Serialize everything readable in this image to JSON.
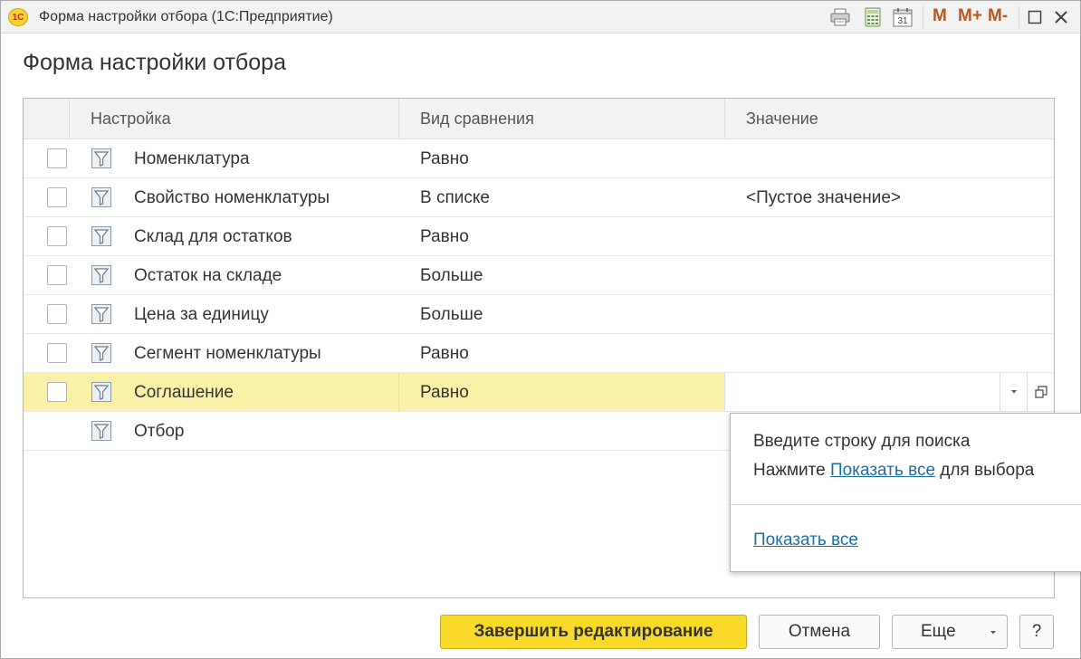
{
  "window": {
    "logo_text": "1С",
    "title": "Форма настройки отбора  (1С:Предприятие)",
    "buttons": {
      "m": "M",
      "m_plus": "M+",
      "m_minus": "M-",
      "calendar_day": "31"
    }
  },
  "page_title": "Форма настройки отбора",
  "table": {
    "columns": {
      "setting": "Настройка",
      "comparison": "Вид сравнения",
      "value": "Значение"
    },
    "rows": [
      {
        "name": "Номенклатура",
        "comparison": "Равно",
        "value": "",
        "has_checkbox": true
      },
      {
        "name": "Свойство номенклатуры",
        "comparison": "В списке",
        "value": "<Пустое значение>",
        "has_checkbox": true
      },
      {
        "name": "Склад для остатков",
        "comparison": "Равно",
        "value": "",
        "has_checkbox": true
      },
      {
        "name": "Остаток на складе",
        "comparison": "Больше",
        "value": "",
        "has_checkbox": true
      },
      {
        "name": "Цена за единицу",
        "comparison": "Больше",
        "value": "",
        "has_checkbox": true
      },
      {
        "name": "Сегмент номенклатуры",
        "comparison": "Равно",
        "value": "",
        "has_checkbox": true
      },
      {
        "name": "Соглашение",
        "comparison": "Равно",
        "value": "",
        "has_checkbox": true,
        "selected": true
      },
      {
        "name": "Отбор",
        "comparison": "",
        "value": "",
        "has_checkbox": false
      }
    ]
  },
  "popup": {
    "hint_line1": "Введите строку для поиска",
    "hint_line2_prefix": "Нажмите",
    "hint_line2_link": "Показать все",
    "hint_line2_suffix": "для выбора",
    "show_all_link": "Показать все"
  },
  "footer": {
    "finish_label": "Завершить редактирование",
    "cancel_label": "Отмена",
    "more_label": "Еще",
    "help_label": "?"
  },
  "colors": {
    "primary_button": "#f9da28",
    "selected_row": "#faf1a9",
    "link": "#1a6ea8",
    "m_buttons": "#b25a22"
  }
}
